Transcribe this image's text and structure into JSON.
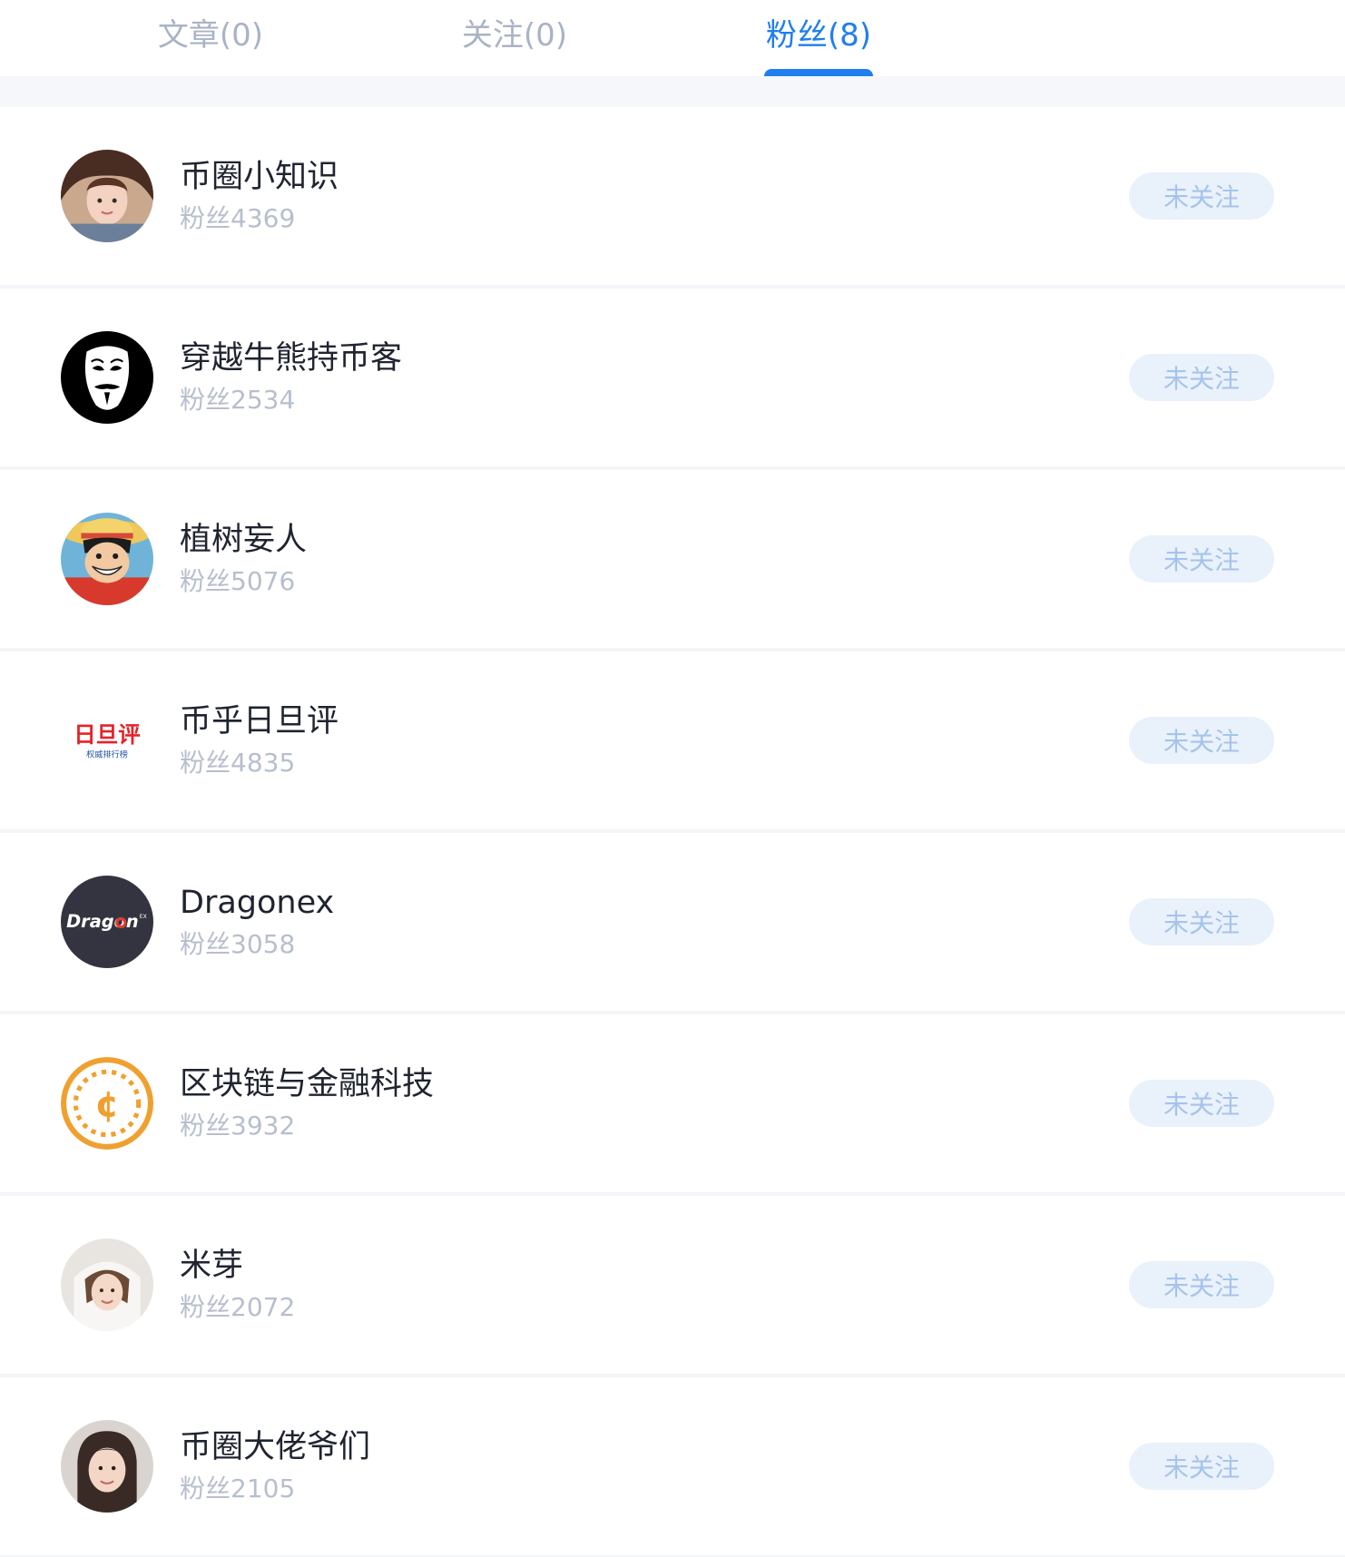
{
  "tabs": [
    {
      "label": "文章(0)",
      "active": false
    },
    {
      "label": "关注(0)",
      "active": false
    },
    {
      "label": "粉丝(8)",
      "active": true
    }
  ],
  "fans_list": [
    {
      "name": "币圈小知识",
      "fans": "粉丝4369",
      "button": "未关注",
      "avatar": "woman-photo-avatar"
    },
    {
      "name": "穿越牛熊持币客",
      "fans": "粉丝2534",
      "button": "未关注",
      "avatar": "mask-avatar"
    },
    {
      "name": "植树妄人",
      "fans": "粉丝5076",
      "button": "未关注",
      "avatar": "anime-character-avatar"
    },
    {
      "name": "币乎日旦评",
      "fans": "粉丝4835",
      "button": "未关注",
      "avatar": "ridanping-logo-avatar",
      "avatar_text": "日旦评",
      "avatar_subtext": "权威排行榜"
    },
    {
      "name": "Dragonex",
      "fans": "粉丝3058",
      "button": "未关注",
      "avatar": "dragonex-logo-avatar",
      "avatar_text": "Dragon",
      "avatar_subtext": "EX"
    },
    {
      "name": "区块链与金融科技",
      "fans": "粉丝3932",
      "button": "未关注",
      "avatar": "coin-icon-avatar",
      "avatar_text": "¢"
    },
    {
      "name": "米芽",
      "fans": "粉丝2072",
      "button": "未关注",
      "avatar": "woman-photo-avatar"
    },
    {
      "name": "币圈大佬爷们",
      "fans": "粉丝2105",
      "button": "未关注",
      "avatar": "woman-photo-avatar"
    }
  ],
  "colors": {
    "accent": "#1f7ef0",
    "tab_inactive": "#a9b3c6",
    "name": "#1f2430",
    "fans": "#b7bfcd",
    "button_bg": "#e9f1fb",
    "button_text": "#a6c4ea",
    "coin": "#f0a030",
    "ridanping_red": "#e62129"
  }
}
